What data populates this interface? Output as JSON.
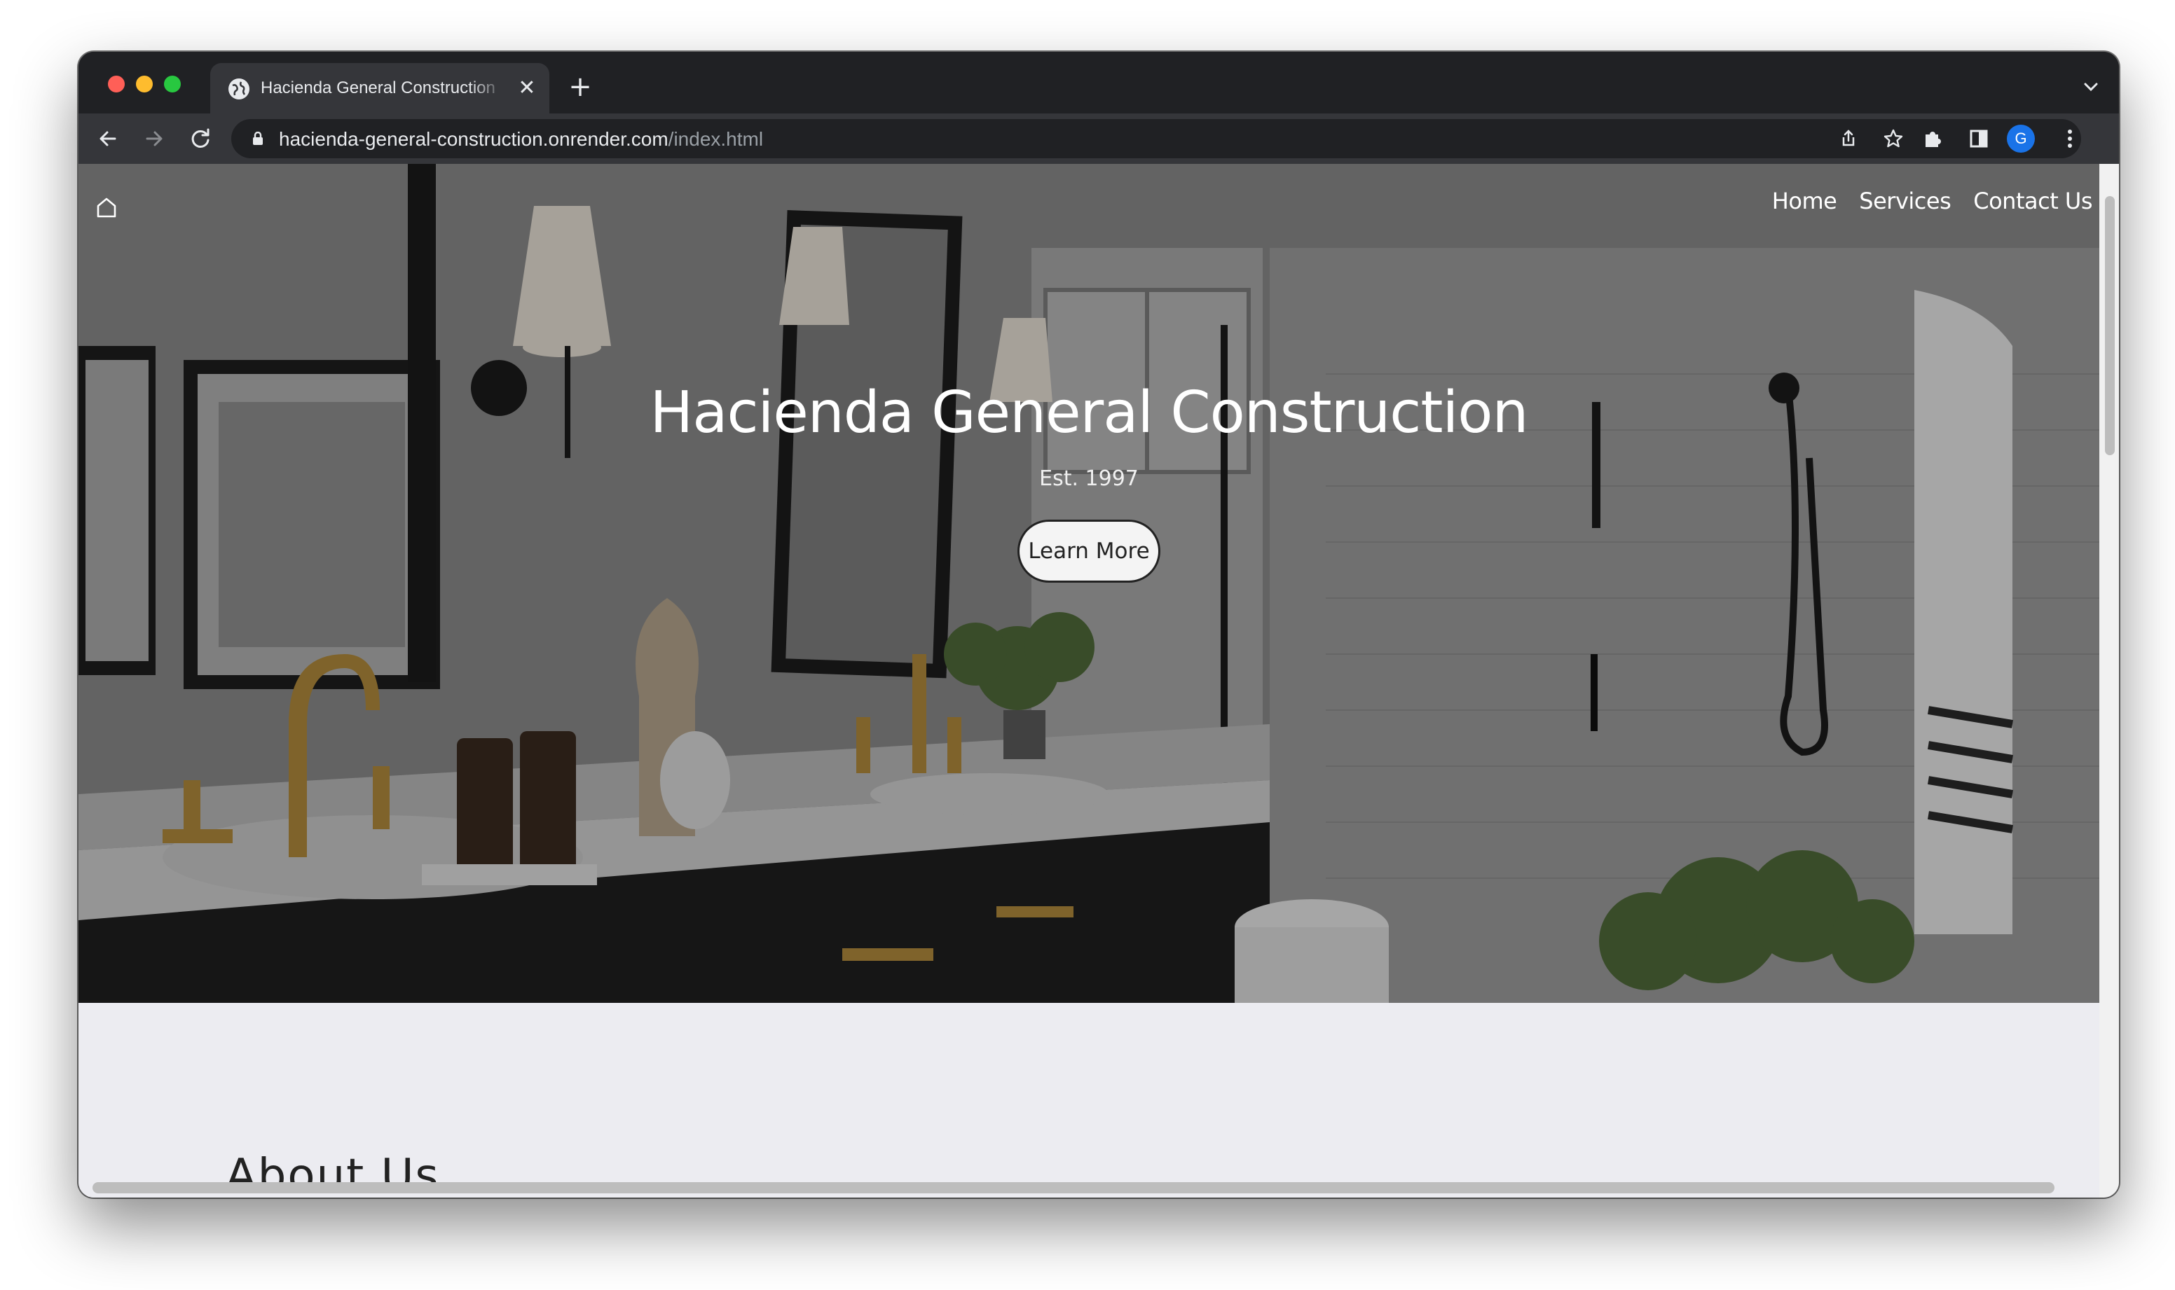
{
  "browser": {
    "tab_title": "Hacienda General Construction",
    "tab_close": "✕",
    "new_tab": "+",
    "url_host": "hacienda-general-construction.onrender.com",
    "url_path": "/index.html",
    "profile_initial": "G"
  },
  "site": {
    "nav": [
      {
        "label": "Home"
      },
      {
        "label": "Services"
      },
      {
        "label": "Contact Us"
      }
    ],
    "hero": {
      "title": "Hacienda General Construction",
      "subtitle": "Est. 1997",
      "cta": "Learn More"
    },
    "next_section_peek": "About Us"
  },
  "icons": {
    "home": "home-icon",
    "back": "back-arrow-icon",
    "forward": "forward-arrow-icon",
    "reload": "reload-icon",
    "lock": "lock-icon",
    "share": "share-icon",
    "bookmark": "star-icon",
    "extensions": "puzzle-icon",
    "sidepanel": "side-panel-icon",
    "menu": "kebab-menu-icon"
  },
  "colors": {
    "chrome_dark": "#202124",
    "toolbar": "#35363a",
    "page_bg": "#ececf1",
    "button_bg": "#f4f4f4"
  }
}
